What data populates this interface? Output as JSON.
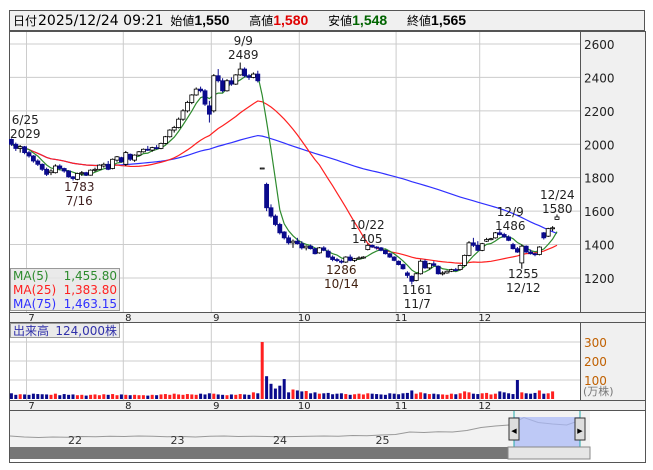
{
  "header": {
    "date_label": "日付",
    "datetime": "2025/12/24 09:21",
    "open_label": "始値",
    "open": "1,550",
    "high_label": "高値",
    "high": "1,580",
    "low_label": "安値",
    "low": "1,548",
    "close_label": "終値",
    "close": "1,565"
  },
  "legend": {
    "ma5_label": "MA(5)",
    "ma5": "1,455.80",
    "ma25_label": "MA(25)",
    "ma25": "1,383.80",
    "ma75_label": "MA(75)",
    "ma75": "1,463.15",
    "volume_label": "出来高",
    "volume": "124,000株"
  },
  "annotations": {
    "a1_date": "6/25",
    "a1_val": "2029",
    "a2_val": "1783",
    "a2_date": "7/16",
    "a3_date": "9/9",
    "a3_val": "2489",
    "a4_val": "1286",
    "a4_date": "10/14",
    "a5_date": "10/22",
    "a5_val": "1405",
    "a6_val": "1161",
    "a6_date": "11/7",
    "a7_date": "12/9",
    "a7_val": "1486",
    "a8_val": "1255",
    "a8_date": "12/12",
    "a9_date": "12/24",
    "a9_val": "1580"
  },
  "colors": {
    "up_fill": "#ffffff",
    "down_fill": "#0a0a8c",
    "ma5": "#2e8b2e",
    "ma25": "#ff2020",
    "ma75": "#3030ff",
    "vol_up": "#ff2020",
    "vol_down": "#0a0a8c"
  },
  "chart_data": {
    "type": "candlestick",
    "price_axis": {
      "ticks": [
        2600,
        2400,
        2200,
        2000,
        1800,
        1600,
        1400,
        1200
      ],
      "range": [
        1100,
        2670
      ]
    },
    "volume_axis": {
      "ticks": [
        300,
        200,
        100
      ],
      "unit": "(万株)"
    },
    "months": [
      "7",
      "8",
      "9",
      "10",
      "11",
      "12"
    ],
    "month_start_index": [
      4,
      26,
      46,
      66,
      88,
      107
    ],
    "candles": [
      [
        2029,
        2035,
        1990,
        2000
      ],
      [
        2000,
        2010,
        1960,
        1975
      ],
      [
        1975,
        1995,
        1950,
        1985
      ],
      [
        1985,
        1990,
        1940,
        1950
      ],
      [
        1950,
        1960,
        1920,
        1930
      ],
      [
        1930,
        1935,
        1890,
        1900
      ],
      [
        1900,
        1910,
        1870,
        1880
      ],
      [
        1880,
        1885,
        1840,
        1850
      ],
      [
        1850,
        1860,
        1810,
        1820
      ],
      [
        1830,
        1850,
        1815,
        1840
      ],
      [
        1830,
        1880,
        1825,
        1870
      ],
      [
        1870,
        1880,
        1845,
        1855
      ],
      [
        1855,
        1860,
        1830,
        1840
      ],
      [
        1840,
        1845,
        1800,
        1805
      ],
      [
        1805,
        1810,
        1783,
        1795
      ],
      [
        1790,
        1830,
        1785,
        1825
      ],
      [
        1825,
        1840,
        1810,
        1830
      ],
      [
        1830,
        1835,
        1810,
        1815
      ],
      [
        1815,
        1850,
        1812,
        1845
      ],
      [
        1845,
        1860,
        1835,
        1850
      ],
      [
        1850,
        1880,
        1848,
        1875
      ],
      [
        1870,
        1890,
        1860,
        1880
      ],
      [
        1880,
        1900,
        1845,
        1850
      ],
      [
        1855,
        1915,
        1850,
        1910
      ],
      [
        1905,
        1930,
        1895,
        1925
      ],
      [
        1920,
        1925,
        1890,
        1895
      ],
      [
        1880,
        1960,
        1870,
        1950
      ],
      [
        1940,
        1945,
        1900,
        1910
      ],
      [
        1905,
        1940,
        1895,
        1935
      ],
      [
        1935,
        1960,
        1930,
        1955
      ],
      [
        1955,
        1975,
        1950,
        1970
      ],
      [
        1970,
        1990,
        1960,
        1965
      ],
      [
        1965,
        1985,
        1955,
        1980
      ],
      [
        1980,
        1995,
        1970,
        1975
      ],
      [
        1975,
        2010,
        1970,
        2005
      ],
      [
        2005,
        2050,
        2000,
        2045
      ],
      [
        2045,
        2090,
        2040,
        2085
      ],
      [
        2085,
        2110,
        2070,
        2100
      ],
      [
        2100,
        2160,
        2095,
        2150
      ],
      [
        2150,
        2210,
        2140,
        2200
      ],
      [
        2200,
        2260,
        2190,
        2250
      ],
      [
        2250,
        2300,
        2240,
        2295
      ],
      [
        2295,
        2340,
        2290,
        2330
      ],
      [
        2330,
        2345,
        2310,
        2320
      ],
      [
        2320,
        2330,
        2230,
        2240
      ],
      [
        2230,
        2260,
        2130,
        2180
      ],
      [
        2200,
        2420,
        2190,
        2410
      ],
      [
        2410,
        2450,
        2370,
        2380
      ],
      [
        2380,
        2395,
        2310,
        2320
      ],
      [
        2320,
        2390,
        2315,
        2380
      ],
      [
        2380,
        2400,
        2350,
        2360
      ],
      [
        2360,
        2420,
        2355,
        2415
      ],
      [
        2415,
        2489,
        2410,
        2450
      ],
      [
        2450,
        2460,
        2400,
        2410
      ],
      [
        2410,
        2420,
        2385,
        2400
      ],
      [
        2400,
        2430,
        2395,
        2420
      ],
      [
        2420,
        2440,
        2370,
        2380
      ],
      [
        1858,
        1858,
        1858,
        1858
      ],
      [
        1760,
        1770,
        1600,
        1620
      ],
      [
        1620,
        1640,
        1560,
        1570
      ],
      [
        1570,
        1580,
        1510,
        1520
      ],
      [
        1520,
        1530,
        1460,
        1470
      ],
      [
        1475,
        1480,
        1430,
        1440
      ],
      [
        1440,
        1455,
        1400,
        1410
      ],
      [
        1410,
        1430,
        1380,
        1420
      ],
      [
        1420,
        1440,
        1400,
        1405
      ],
      [
        1405,
        1420,
        1370,
        1380
      ],
      [
        1380,
        1395,
        1365,
        1390
      ],
      [
        1390,
        1400,
        1370,
        1375
      ],
      [
        1375,
        1380,
        1340,
        1345
      ],
      [
        1350,
        1385,
        1345,
        1380
      ],
      [
        1380,
        1390,
        1360,
        1365
      ],
      [
        1360,
        1370,
        1320,
        1325
      ],
      [
        1325,
        1335,
        1300,
        1310
      ],
      [
        1310,
        1320,
        1295,
        1305
      ],
      [
        1300,
        1310,
        1286,
        1295
      ],
      [
        1295,
        1330,
        1290,
        1325
      ],
      [
        1325,
        1340,
        1300,
        1305
      ],
      [
        1305,
        1320,
        1295,
        1315
      ],
      [
        1315,
        1330,
        1310,
        1320
      ],
      [
        1320,
        1330,
        1315,
        1325
      ],
      [
        1370,
        1405,
        1365,
        1395
      ],
      [
        1395,
        1400,
        1380,
        1385
      ],
      [
        1385,
        1390,
        1370,
        1380
      ],
      [
        1380,
        1385,
        1360,
        1365
      ],
      [
        1365,
        1370,
        1340,
        1345
      ],
      [
        1345,
        1350,
        1320,
        1325
      ],
      [
        1325,
        1330,
        1300,
        1305
      ],
      [
        1300,
        1305,
        1275,
        1280
      ],
      [
        1280,
        1285,
        1250,
        1255
      ],
      [
        1230,
        1240,
        1200,
        1215
      ],
      [
        1210,
        1215,
        1161,
        1180
      ],
      [
        1185,
        1230,
        1180,
        1225
      ],
      [
        1225,
        1310,
        1220,
        1300
      ],
      [
        1300,
        1310,
        1255,
        1260
      ],
      [
        1260,
        1290,
        1250,
        1285
      ],
      [
        1285,
        1300,
        1270,
        1275
      ],
      [
        1270,
        1275,
        1220,
        1225
      ],
      [
        1225,
        1240,
        1215,
        1230
      ],
      [
        1230,
        1245,
        1225,
        1240
      ],
      [
        1240,
        1255,
        1235,
        1250
      ],
      [
        1250,
        1260,
        1240,
        1245
      ],
      [
        1250,
        1280,
        1245,
        1275
      ],
      [
        1275,
        1340,
        1270,
        1335
      ],
      [
        1335,
        1420,
        1330,
        1410
      ],
      [
        1410,
        1440,
        1385,
        1395
      ],
      [
        1395,
        1420,
        1360,
        1365
      ],
      [
        1365,
        1410,
        1360,
        1405
      ],
      [
        1420,
        1440,
        1415,
        1430
      ],
      [
        1430,
        1440,
        1425,
        1435
      ],
      [
        1440,
        1475,
        1435,
        1470
      ],
      [
        1470,
        1486,
        1455,
        1460
      ],
      [
        1460,
        1470,
        1440,
        1445
      ],
      [
        1445,
        1455,
        1420,
        1425
      ],
      [
        1400,
        1410,
        1370,
        1375
      ],
      [
        1375,
        1385,
        1350,
        1355
      ],
      [
        1290,
        1400,
        1255,
        1390
      ],
      [
        1390,
        1395,
        1350,
        1355
      ],
      [
        1355,
        1370,
        1340,
        1345
      ],
      [
        1345,
        1350,
        1330,
        1340
      ],
      [
        1340,
        1390,
        1335,
        1385
      ],
      [
        1470,
        1475,
        1430,
        1440
      ],
      [
        1450,
        1500,
        1445,
        1495
      ],
      [
        1495,
        1510,
        1480,
        1500
      ],
      [
        1550,
        1580,
        1548,
        1565
      ]
    ],
    "volume": [
      30,
      22,
      25,
      24,
      22,
      28,
      26,
      25,
      24,
      22,
      28,
      20,
      26,
      22,
      24,
      20,
      22,
      18,
      22,
      24,
      20,
      25,
      22,
      26,
      20,
      24,
      22,
      20,
      22,
      20,
      20,
      18,
      22,
      20,
      24,
      26,
      22,
      28,
      24,
      22,
      26,
      24,
      22,
      28,
      24,
      30,
      28,
      24,
      22,
      20,
      24,
      22,
      26,
      24,
      22,
      35,
      30,
      300,
      120,
      80,
      55,
      70,
      105,
      35,
      50,
      45,
      40,
      42,
      30,
      35,
      28,
      30,
      32,
      25,
      28,
      30,
      26,
      22,
      25,
      28,
      24,
      30,
      28,
      26,
      24,
      22,
      30,
      28,
      25,
      30,
      32,
      45,
      28,
      35,
      30,
      26,
      28,
      25,
      24,
      22,
      28,
      25,
      30,
      40,
      35,
      28,
      26,
      30,
      32,
      24,
      28,
      40,
      35,
      30,
      26,
      100,
      35,
      30,
      28,
      32,
      45,
      28,
      30,
      40
    ],
    "navigator": {
      "labels": [
        "22",
        "23",
        "24",
        "25"
      ],
      "series": [
        1180,
        1160,
        1150,
        1160,
        1155,
        1170,
        1165,
        1175,
        1170,
        1180,
        1175,
        1165,
        1170,
        1160,
        1175,
        1180,
        1170,
        1175,
        1170,
        1165,
        1170,
        1175,
        1180,
        1175,
        1190,
        1185,
        1200,
        1210,
        1260,
        1250,
        1265,
        1260,
        1290,
        1350,
        1380,
        1400,
        1550,
        1450,
        1420,
        1400,
        1500
      ]
    }
  }
}
